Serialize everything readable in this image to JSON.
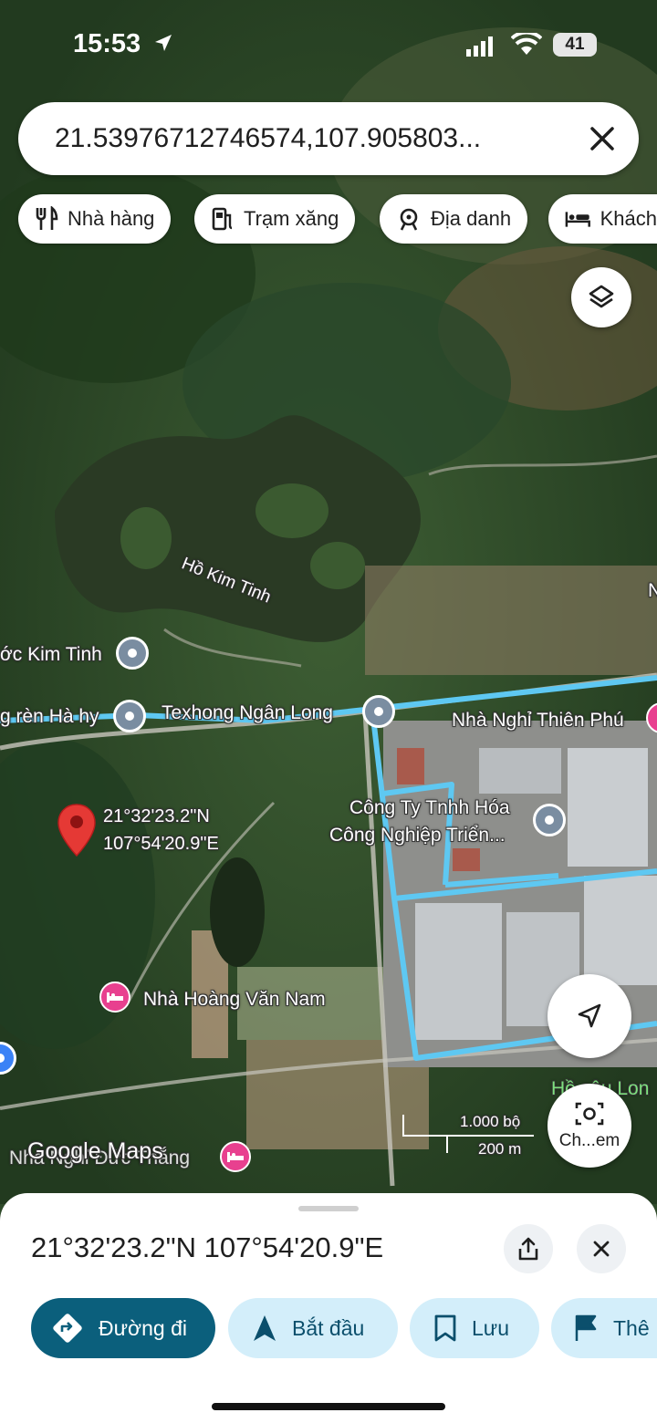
{
  "status_bar": {
    "time": "15:53",
    "battery": "41"
  },
  "search": {
    "query": "21.53976712746574,107.905803..."
  },
  "chips": [
    {
      "label": "Nhà hàng",
      "icon": "fork-knife-icon"
    },
    {
      "label": "Trạm xăng",
      "icon": "gas-station-icon"
    },
    {
      "label": "Địa danh",
      "icon": "landmark-icon"
    },
    {
      "label": "Khách",
      "icon": "bed-icon"
    }
  ],
  "map": {
    "lake_label": "Hồ Kim Tinh",
    "places": {
      "kim_tinh": "ớc Kim Tinh",
      "ha_hy": "g rèn Hà hy",
      "texhong": "Texhong Ngân Long",
      "thien_phu": "Nhà Nghỉ Thiên Phú",
      "hoa_line1": "Công Ty Tnhh Hóa",
      "hoa_line2": "Công Nghiệp Triển...",
      "hoang_van_nam": "Nhà Hoàng Văn Nam",
      "duc_thang": "Nhà Nghỉ Đức Thắng",
      "ho_lon": "Hồ câu Lon",
      "edge_n": "N"
    },
    "pin_label": {
      "line1": "21°32'23.2\"N",
      "line2": "107°54'20.9\"E"
    },
    "scale": {
      "feet": "1.000 bộ",
      "meters": "200 m"
    },
    "watermark": "Google Maps",
    "camera_label": "Ch...em",
    "colors": {
      "route": "#5ec8f2",
      "pin": "#e53935",
      "hotel": "#e8408f",
      "poi": "#7a8da1"
    }
  },
  "sheet": {
    "coordinates": "21°32'23.2\"N 107°54'20.9\"E",
    "actions": [
      {
        "label": "Đường đi",
        "icon": "directions-icon"
      },
      {
        "label": "Bắt đầu",
        "icon": "navigation-arrow-icon"
      },
      {
        "label": "Lưu",
        "icon": "bookmark-icon"
      },
      {
        "label": "Thê",
        "icon": "flag-icon"
      }
    ]
  }
}
